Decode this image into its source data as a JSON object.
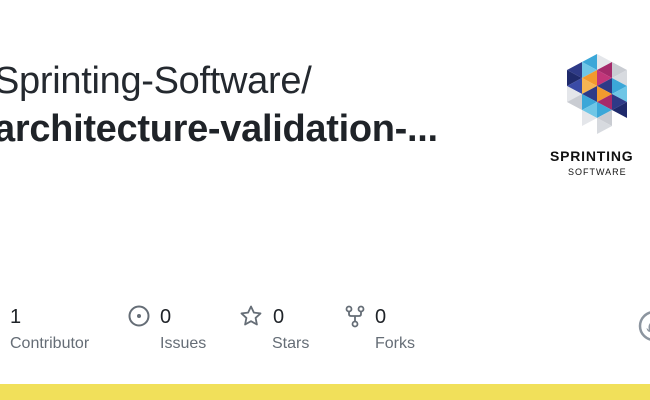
{
  "repo": {
    "owner": "Sprinting-Software/",
    "name": "architecture-validation-..."
  },
  "logo": {
    "wordmark": "SPRINTING",
    "subtitle": "SOFTWARE",
    "colors": [
      "#2e3a87",
      "#3ba7d8",
      "#f29a2e",
      "#a52a6b",
      "#6fc6e6",
      "#e4e6ea"
    ]
  },
  "stats": [
    {
      "count": "1",
      "label": "Contributor",
      "icon": "people-icon"
    },
    {
      "count": "0",
      "label": "Issues",
      "icon": "issue-opened-icon"
    },
    {
      "count": "0",
      "label": "Stars",
      "icon": "star-icon"
    },
    {
      "count": "0",
      "label": "Forks",
      "icon": "repo-forked-icon"
    }
  ],
  "colors": {
    "text": "#1f2328",
    "muted": "#656d76",
    "language_bar": "#f1e05a"
  }
}
